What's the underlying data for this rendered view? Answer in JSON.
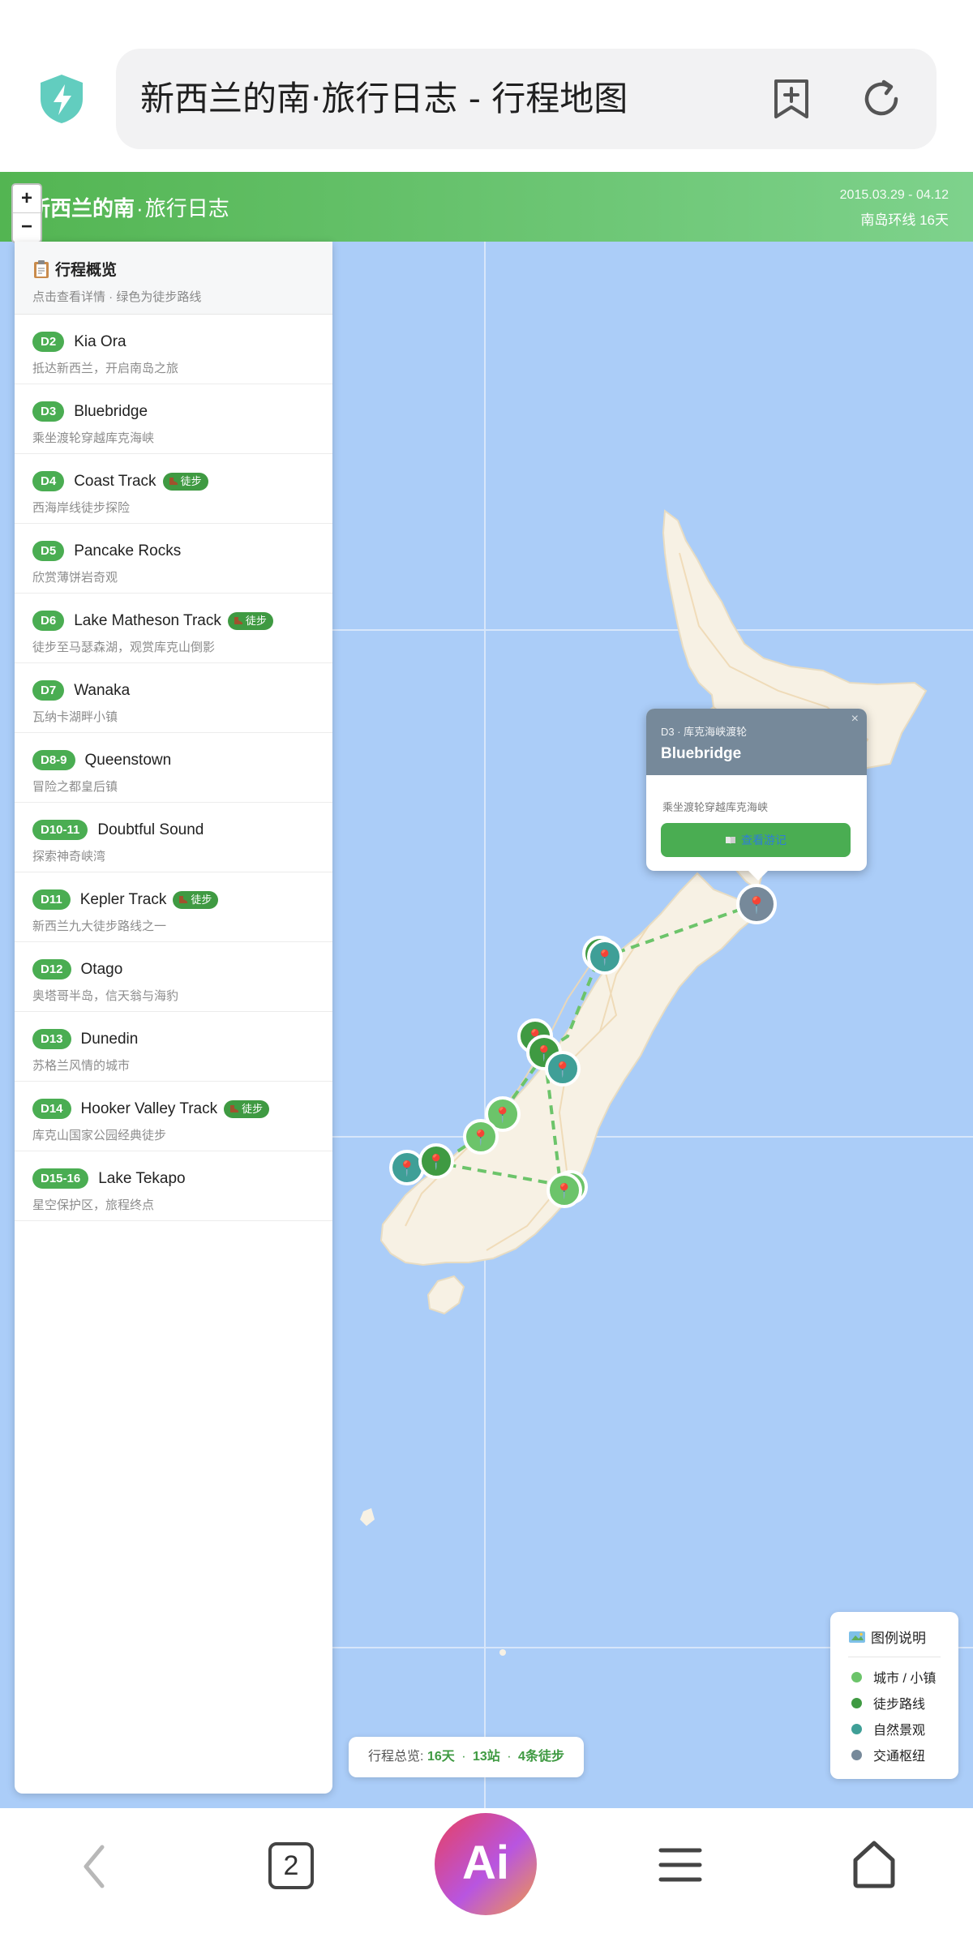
{
  "browser": {
    "url_title": "新西兰的南·旅行日志 - 行程地图",
    "tab_count": "2",
    "ai_label": "Ai"
  },
  "header": {
    "title_strong": "新西兰的南",
    "title_sep": "·",
    "title_rest": "旅行日志",
    "dates": "2015.03.29 - 04.12",
    "summary": "南岛环线 16天"
  },
  "zoom": {
    "in": "+",
    "out": "−"
  },
  "sidebar": {
    "title": "行程概览",
    "subtitle": "点击查看详情 · 绿色为徒步路线",
    "hike_tag": "徒步",
    "items": [
      {
        "day": "D2",
        "name": "Kia Ora",
        "desc": "抵达新西兰，开启南岛之旅",
        "hike": false
      },
      {
        "day": "D3",
        "name": "Bluebridge",
        "desc": "乘坐渡轮穿越库克海峡",
        "hike": false
      },
      {
        "day": "D4",
        "name": "Coast Track",
        "desc": "西海岸线徒步探险",
        "hike": true
      },
      {
        "day": "D5",
        "name": "Pancake Rocks",
        "desc": "欣赏薄饼岩奇观",
        "hike": false
      },
      {
        "day": "D6",
        "name": "Lake Matheson Track",
        "desc": "徒步至马瑟森湖，观赏库克山倒影",
        "hike": true
      },
      {
        "day": "D7",
        "name": "Wanaka",
        "desc": "瓦纳卡湖畔小镇",
        "hike": false
      },
      {
        "day": "D8-9",
        "name": "Queenstown",
        "desc": "冒险之都皇后镇",
        "hike": false
      },
      {
        "day": "D10-11",
        "name": "Doubtful Sound",
        "desc": "探索神奇峡湾",
        "hike": false
      },
      {
        "day": "D11",
        "name": "Kepler Track",
        "desc": "新西兰九大徒步路线之一",
        "hike": true
      },
      {
        "day": "D12",
        "name": "Otago",
        "desc": "奥塔哥半岛，信天翁与海豹",
        "hike": false
      },
      {
        "day": "D13",
        "name": "Dunedin",
        "desc": "苏格兰风情的城市",
        "hike": false
      },
      {
        "day": "D14",
        "name": "Hooker Valley Track",
        "desc": "库克山国家公园经典徒步",
        "hike": true
      },
      {
        "day": "D15-16",
        "name": "Lake Tekapo",
        "desc": "星空保护区，旅程终点",
        "hike": false
      }
    ]
  },
  "popup": {
    "kicker": "D3 · 库克海峡渡轮",
    "title": "Bluebridge",
    "desc": "乘坐渡轮穿越库克海峡",
    "button": "查看游记",
    "close": "×"
  },
  "stats": {
    "label": "行程总览:",
    "days": "16天",
    "stops": "13站",
    "hikes": "4条徒步",
    "sep": "·"
  },
  "legend": {
    "title": "图例说明",
    "items": [
      {
        "label": "城市 / 小镇",
        "color": "#6cc46a"
      },
      {
        "label": "徒步路线",
        "color": "#3f9a42"
      },
      {
        "label": "自然景观",
        "color": "#3f9f97"
      },
      {
        "label": "交通枢纽",
        "color": "#76899a"
      }
    ]
  },
  "colors": {
    "accent": "#4aad52",
    "header_gradient_start": "#53b552",
    "header_gradient_end": "#7ed28c",
    "sea": "#abcdf8",
    "land": "#f7f1e4"
  },
  "icons": [
    "shield-icon",
    "bookmark-add-icon",
    "reload-icon",
    "clipboard-icon",
    "boot-icon",
    "map-pin-icon",
    "book-icon",
    "map-icon",
    "back-icon",
    "menu-icon",
    "home-icon"
  ]
}
